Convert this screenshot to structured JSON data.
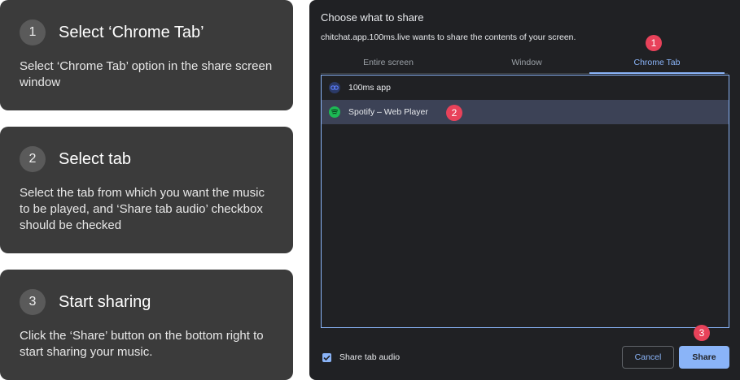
{
  "steps": [
    {
      "number": "1",
      "title": "Select ‘Chrome Tab’",
      "description": "Select ‘Chrome Tab’ option in the share screen window"
    },
    {
      "number": "2",
      "title": "Select tab",
      "description": "Select the tab from which you want the music to be played, and ‘Share tab audio’ checkbox should be checked"
    },
    {
      "number": "3",
      "title": "Start sharing",
      "description": "Click the ‘Share’ button on the bottom right to start sharing your music."
    }
  ],
  "dialog": {
    "title": "Choose what to share",
    "subtitle": "chitchat.app.100ms.live wants to share the contents of your screen.",
    "tabs": [
      "Entire screen",
      "Window",
      "Chrome Tab"
    ],
    "active_tab": "Chrome Tab",
    "items": [
      {
        "label": "100ms app",
        "icon": "100ms-favicon-icon"
      },
      {
        "label": "Spotify – Web Player",
        "icon": "spotify-favicon-icon",
        "selected": true
      }
    ],
    "share_audio_label": "Share tab audio",
    "share_audio_checked": true,
    "cancel_label": "Cancel",
    "share_label": "Share"
  },
  "markers": [
    "1",
    "2",
    "3"
  ],
  "colors": {
    "card_bg": "#3b3b3b",
    "dialog_bg": "#202124",
    "accent": "#8ab4f8",
    "marker": "#e8425a",
    "selected_row": "#3c4256"
  }
}
